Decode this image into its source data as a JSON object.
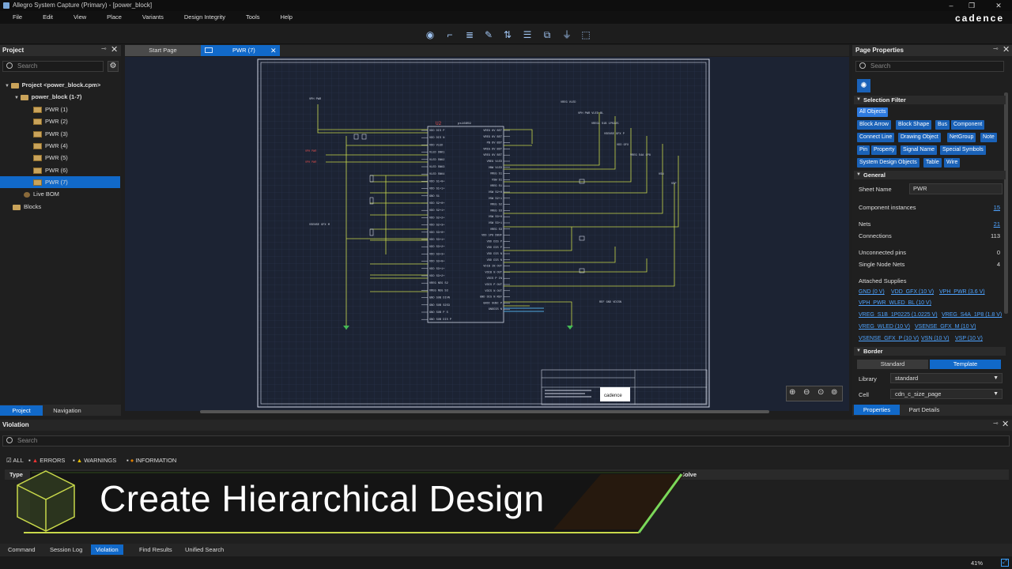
{
  "window": {
    "title": "Allegro System Capture (Primary) - [power_block]",
    "brand": "cadence"
  },
  "menu": [
    "File",
    "Edit",
    "View",
    "Place",
    "Variants",
    "Design Integrity",
    "Tools",
    "Help"
  ],
  "toolbar_icons": [
    "zoom-fit-icon",
    "wire-icon",
    "bus-icon",
    "draw-icon",
    "net-icon",
    "text-icon",
    "component-icon",
    "ground-icon",
    "select-icon"
  ],
  "project_panel": {
    "title": "Project",
    "search_placeholder": "Search",
    "tree": [
      {
        "label": "Project <power_block.cpm>",
        "level": 0,
        "icon": "folder"
      },
      {
        "label": "power_block (1-7)",
        "level": 1,
        "icon": "folder"
      },
      {
        "label": "PWR (1)",
        "level": 2,
        "icon": "page"
      },
      {
        "label": "PWR (2)",
        "level": 2,
        "icon": "page"
      },
      {
        "label": "PWR (3)",
        "level": 2,
        "icon": "page"
      },
      {
        "label": "PWR (4)",
        "level": 2,
        "icon": "page"
      },
      {
        "label": "PWR (5)",
        "level": 2,
        "icon": "page"
      },
      {
        "label": "PWR (6)",
        "level": 2,
        "icon": "page"
      },
      {
        "label": "PWR (7)",
        "level": 2,
        "icon": "page",
        "selected": true
      },
      {
        "label": "Live BOM",
        "level": 1,
        "icon": "bom"
      },
      {
        "label": "Blocks",
        "level": 0,
        "icon": "folder"
      }
    ],
    "tabs": [
      "Project",
      "Navigation"
    ]
  },
  "doc_tabs": [
    {
      "label": "Start Page"
    },
    {
      "label": "PWR (7)",
      "active": true
    }
  ],
  "schematic": {
    "ref": "U2",
    "part": "ps16859",
    "left_pins": [
      "VDD DIS P",
      "VDD DIS N",
      "VDD VLED",
      "VLED SNK1",
      "VLED SNK2",
      "VLED SNK3",
      "VLED SNK4",
      "VDD S1+0+",
      "VDD S1+1+",
      "GND S1",
      "VDD S2+0+",
      "VDD S2+1+",
      "VDD S2+2+",
      "VDD S2+3+",
      "VDD S3+0+",
      "VDD S3+1+",
      "VDD S3+2+",
      "VDD S3+3+",
      "VDD S3+0+",
      "VDD S3+1+",
      "VDD S3+2+",
      "VREG NEG S2",
      "VREG NEG S3",
      "GND SUB DIVN",
      "GND SUB S2S3",
      "GND SUB P S",
      "GND SUB DIS P"
    ],
    "right_pins": [
      "VREG 6V BST",
      "VREG 6V BST",
      "PB 6V BST",
      "VREG 6V BST",
      "VREG 6V BST",
      "VREG VLED",
      "VBW VLED",
      "VREG S1",
      "VSW S1",
      "VREG S1",
      "VSW S2+0",
      "VSW S2+1",
      "VREG S2",
      "VREG S3",
      "VSW S3+0",
      "VSW S3+1",
      "VREG S3",
      "VDD 1P8 DBUF",
      "VDD DIS P",
      "VDD DIS P",
      "VDD DIS N",
      "VDD DIS N",
      "VDIB IN OUT",
      "VDIB N OUT",
      "VDIS P IN",
      "VDIS P OUT",
      "VDIS N OUT",
      "GND DIS N REF",
      "GNDC SUBC P",
      "GNDDIS N"
    ],
    "net_labels": [
      "VPH PWR",
      "VREG VLED",
      "VPH PWR VLED BL",
      "VREG1 S1B 1P0225",
      "VSENSE GFX P",
      "VDD GFX",
      "VREG S4A 1P8",
      "VSN",
      "VSP",
      "VSENSE GFX M",
      "REF GND VDISN"
    ],
    "title_block_logo": "cadence"
  },
  "zoom_buttons": [
    "zoom-in-icon",
    "zoom-out-icon",
    "zoom-area-icon",
    "zoom-fit-icon"
  ],
  "properties": {
    "title": "Page Properties",
    "search_placeholder": "Search",
    "selection_filter_title": "Selection Filter",
    "filters": [
      "All Objects",
      "Block Arrow",
      "Block Shape",
      "Bus",
      "Component",
      "Connect Line",
      "Drawing Object",
      "NetGroup",
      "Note",
      "Pin",
      "Property",
      "Signal Name",
      "Special Symbols",
      "System Design Objects",
      "Table",
      "Wire"
    ],
    "general_title": "General",
    "sheet_name_label": "Sheet Name",
    "sheet_name": "PWR",
    "rows": [
      {
        "label": "Component instances",
        "value": "15",
        "link": true
      },
      {
        "label": "Nets",
        "value": "21",
        "link": true
      },
      {
        "label": "Connections",
        "value": "113",
        "link": false
      },
      {
        "label": "Unconnected pins",
        "value": "0",
        "link": false
      },
      {
        "label": "Single Node Nets",
        "value": "4",
        "link": false
      }
    ],
    "attached_supplies_label": "Attached Supplies",
    "supplies": [
      "GND (0 V)",
      "VDD_GFX (10 V)",
      "VPH_PWR (3.6 V)",
      "VPH_PWR_WLED_BL (10 V)",
      "VREG_S1B_1P0225 (1.0225 V)",
      "VREG_S4A_1P8 (1.8 V)",
      "VREG_WLED (10 V)",
      "VSENSE_GFX_M (10 V)",
      "VSENSE_GFX_P (10 V)",
      "VSN (10 V)",
      "VSP (10 V)"
    ],
    "border_title": "Border",
    "border_options": [
      "Standard",
      "Template"
    ],
    "library_label": "Library",
    "library_value": "standard",
    "cell_label": "Cell",
    "cell_value": "cdn_c_size_page",
    "tabs": [
      "Properties",
      "Part Details"
    ]
  },
  "violation": {
    "title": "Violation",
    "search_placeholder": "Search",
    "filters": [
      "ALL",
      "ERRORS",
      "WARNINGS",
      "INFORMATION"
    ],
    "col_type": "Type",
    "col_solve": "Solve",
    "banner": "Create Hierarchical Design"
  },
  "bottom_tabs": [
    "Command",
    "Session Log",
    "Violation",
    "Find Results",
    "Unified Search"
  ],
  "status": {
    "zoom": "41%"
  }
}
